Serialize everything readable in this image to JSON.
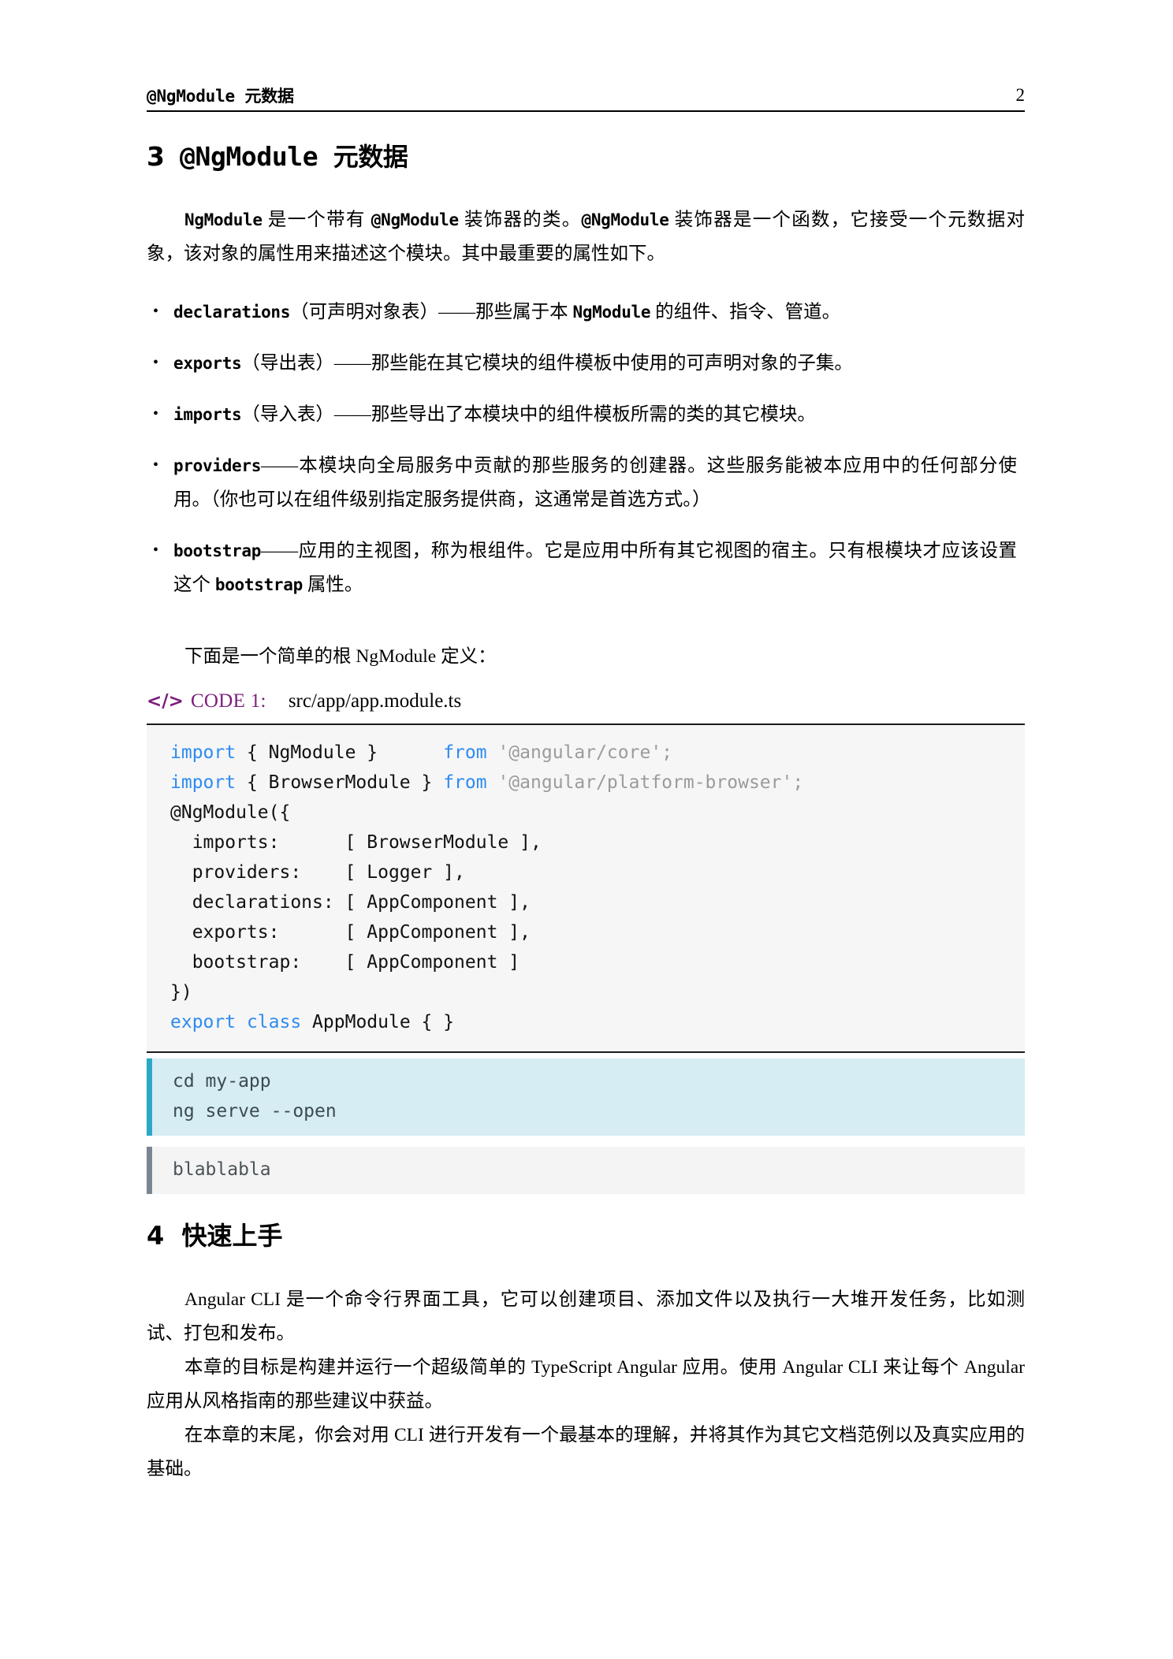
{
  "page": {
    "number": "2",
    "running_header_title_mono": "@NgModule",
    "running_header_title_cjk": "元数据"
  },
  "colors": {
    "code_caption_purple": "#7B1E7B",
    "code_keyword_blue": "#2E8BF0",
    "code_string_gray": "#9B9B9B",
    "code_bg": "#F6F6F6",
    "shell_teal_bg": "#D6EDF3",
    "shell_teal_border": "#2BA8C6",
    "shell_gray_bg": "#F4F4F4",
    "shell_gray_border": "#7A8691"
  },
  "section3": {
    "number": "3",
    "title_mono": "@NgModule",
    "title_cjk": "元数据",
    "intro_code1": "NgModule",
    "intro_part1": " 是一个带有 ",
    "intro_code2": "@NgModule",
    "intro_part2": " 装饰器的类。",
    "intro_code3": "@NgModule",
    "intro_part3": " 装饰器是一个函数，它接受一个元数据对象，该对象的属性用来描述这个模块。其中最重要的属性如下。",
    "bullets": [
      {
        "code": "declarations",
        "text_before_inline": "（可声明对象表）——那些属于本 ",
        "inline_code": "NgModule",
        "text_after_inline": " 的组件、指令、管道。"
      },
      {
        "code": "exports",
        "text_before_inline": "（导出表）——那些能在其它模块的组件模板中使用的可声明对象的子集。",
        "inline_code": "",
        "text_after_inline": ""
      },
      {
        "code": "imports",
        "text_before_inline": "（导入表）——那些导出了本模块中的组件模板所需的类的其它模块。",
        "inline_code": "",
        "text_after_inline": ""
      },
      {
        "code": "providers",
        "text_before_inline": "——本模块向全局服务中贡献的那些服务的创建器。这些服务能被本应用中的任何部分使用。（你也可以在组件级别指定服务提供商，这通常是首选方式。）",
        "inline_code": "",
        "text_after_inline": ""
      },
      {
        "code": "bootstrap",
        "text_before_inline": "——应用的主视图，称为根组件。它是应用中所有其它视图的宿主。只有根模块才应该设置这个 ",
        "inline_code": "bootstrap",
        "text_after_inline": " 属性。"
      }
    ],
    "lead_in": "下面是一个简单的根 NgModule 定义："
  },
  "code_caption": {
    "icon": "code-tag-icon",
    "icon_glyph": "</>",
    "label": "CODE 1:",
    "filename": "src/app/app.module.ts"
  },
  "code_block": {
    "language": "typescript",
    "lines": [
      [
        {
          "t": "import",
          "c": "kw"
        },
        {
          "t": " { NgModule }      ",
          "c": ""
        },
        {
          "t": "from",
          "c": "kw"
        },
        {
          "t": " ",
          "c": ""
        },
        {
          "t": "'@angular/core';",
          "c": "str"
        }
      ],
      [
        {
          "t": "import",
          "c": "kw"
        },
        {
          "t": " { BrowserModule } ",
          "c": ""
        },
        {
          "t": "from",
          "c": "kw"
        },
        {
          "t": " ",
          "c": ""
        },
        {
          "t": "'@angular/platform-browser';",
          "c": "str"
        }
      ],
      [
        {
          "t": "@NgModule({",
          "c": ""
        }
      ],
      [
        {
          "t": "  imports:      [ BrowserModule ],",
          "c": ""
        }
      ],
      [
        {
          "t": "  providers:    [ Logger ],",
          "c": ""
        }
      ],
      [
        {
          "t": "  declarations: [ AppComponent ],",
          "c": ""
        }
      ],
      [
        {
          "t": "  exports:      [ AppComponent ],",
          "c": ""
        }
      ],
      [
        {
          "t": "  bootstrap:    [ AppComponent ]",
          "c": ""
        }
      ],
      [
        {
          "t": "})",
          "c": ""
        }
      ],
      [
        {
          "t": "export",
          "c": "kw"
        },
        {
          "t": " ",
          "c": ""
        },
        {
          "t": "class",
          "c": "kw"
        },
        {
          "t": " AppModule { }",
          "c": ""
        }
      ]
    ]
  },
  "shell_teal": {
    "line1": "cd my-app",
    "line2": "ng serve --open"
  },
  "shell_gray": {
    "line1": "blablabla"
  },
  "section4": {
    "number": "4",
    "title": "快速上手",
    "paragraphs": [
      "Angular CLI 是一个命令行界面工具，它可以创建项目、添加文件以及执行一大堆开发任务，比如测试、打包和发布。",
      "本章的目标是构建并运行一个超级简单的 TypeScript Angular 应用。使用 Angular CLI 来让每个 Angular 应用从风格指南的那些建议中获益。",
      "在本章的末尾，你会对用 CLI 进行开发有一个最基本的理解，并将其作为其它文档范例以及真实应用的基础。"
    ]
  }
}
